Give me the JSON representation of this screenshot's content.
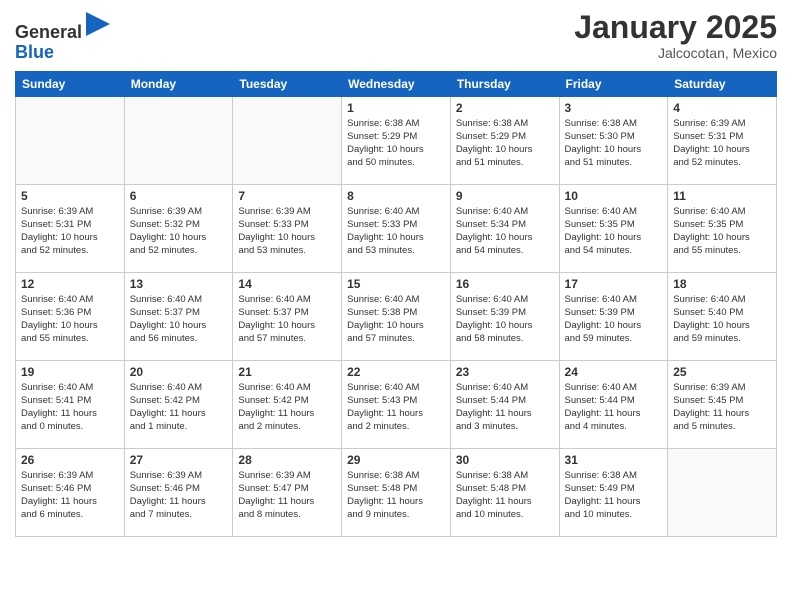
{
  "header": {
    "logo_general": "General",
    "logo_blue": "Blue",
    "month": "January 2025",
    "location": "Jalcocotan, Mexico"
  },
  "weekdays": [
    "Sunday",
    "Monday",
    "Tuesday",
    "Wednesday",
    "Thursday",
    "Friday",
    "Saturday"
  ],
  "weeks": [
    [
      {
        "day": "",
        "info": ""
      },
      {
        "day": "",
        "info": ""
      },
      {
        "day": "",
        "info": ""
      },
      {
        "day": "1",
        "info": "Sunrise: 6:38 AM\nSunset: 5:29 PM\nDaylight: 10 hours\nand 50 minutes."
      },
      {
        "day": "2",
        "info": "Sunrise: 6:38 AM\nSunset: 5:29 PM\nDaylight: 10 hours\nand 51 minutes."
      },
      {
        "day": "3",
        "info": "Sunrise: 6:38 AM\nSunset: 5:30 PM\nDaylight: 10 hours\nand 51 minutes."
      },
      {
        "day": "4",
        "info": "Sunrise: 6:39 AM\nSunset: 5:31 PM\nDaylight: 10 hours\nand 52 minutes."
      }
    ],
    [
      {
        "day": "5",
        "info": "Sunrise: 6:39 AM\nSunset: 5:31 PM\nDaylight: 10 hours\nand 52 minutes."
      },
      {
        "day": "6",
        "info": "Sunrise: 6:39 AM\nSunset: 5:32 PM\nDaylight: 10 hours\nand 52 minutes."
      },
      {
        "day": "7",
        "info": "Sunrise: 6:39 AM\nSunset: 5:33 PM\nDaylight: 10 hours\nand 53 minutes."
      },
      {
        "day": "8",
        "info": "Sunrise: 6:40 AM\nSunset: 5:33 PM\nDaylight: 10 hours\nand 53 minutes."
      },
      {
        "day": "9",
        "info": "Sunrise: 6:40 AM\nSunset: 5:34 PM\nDaylight: 10 hours\nand 54 minutes."
      },
      {
        "day": "10",
        "info": "Sunrise: 6:40 AM\nSunset: 5:35 PM\nDaylight: 10 hours\nand 54 minutes."
      },
      {
        "day": "11",
        "info": "Sunrise: 6:40 AM\nSunset: 5:35 PM\nDaylight: 10 hours\nand 55 minutes."
      }
    ],
    [
      {
        "day": "12",
        "info": "Sunrise: 6:40 AM\nSunset: 5:36 PM\nDaylight: 10 hours\nand 55 minutes."
      },
      {
        "day": "13",
        "info": "Sunrise: 6:40 AM\nSunset: 5:37 PM\nDaylight: 10 hours\nand 56 minutes."
      },
      {
        "day": "14",
        "info": "Sunrise: 6:40 AM\nSunset: 5:37 PM\nDaylight: 10 hours\nand 57 minutes."
      },
      {
        "day": "15",
        "info": "Sunrise: 6:40 AM\nSunset: 5:38 PM\nDaylight: 10 hours\nand 57 minutes."
      },
      {
        "day": "16",
        "info": "Sunrise: 6:40 AM\nSunset: 5:39 PM\nDaylight: 10 hours\nand 58 minutes."
      },
      {
        "day": "17",
        "info": "Sunrise: 6:40 AM\nSunset: 5:39 PM\nDaylight: 10 hours\nand 59 minutes."
      },
      {
        "day": "18",
        "info": "Sunrise: 6:40 AM\nSunset: 5:40 PM\nDaylight: 10 hours\nand 59 minutes."
      }
    ],
    [
      {
        "day": "19",
        "info": "Sunrise: 6:40 AM\nSunset: 5:41 PM\nDaylight: 11 hours\nand 0 minutes."
      },
      {
        "day": "20",
        "info": "Sunrise: 6:40 AM\nSunset: 5:42 PM\nDaylight: 11 hours\nand 1 minute."
      },
      {
        "day": "21",
        "info": "Sunrise: 6:40 AM\nSunset: 5:42 PM\nDaylight: 11 hours\nand 2 minutes."
      },
      {
        "day": "22",
        "info": "Sunrise: 6:40 AM\nSunset: 5:43 PM\nDaylight: 11 hours\nand 2 minutes."
      },
      {
        "day": "23",
        "info": "Sunrise: 6:40 AM\nSunset: 5:44 PM\nDaylight: 11 hours\nand 3 minutes."
      },
      {
        "day": "24",
        "info": "Sunrise: 6:40 AM\nSunset: 5:44 PM\nDaylight: 11 hours\nand 4 minutes."
      },
      {
        "day": "25",
        "info": "Sunrise: 6:39 AM\nSunset: 5:45 PM\nDaylight: 11 hours\nand 5 minutes."
      }
    ],
    [
      {
        "day": "26",
        "info": "Sunrise: 6:39 AM\nSunset: 5:46 PM\nDaylight: 11 hours\nand 6 minutes."
      },
      {
        "day": "27",
        "info": "Sunrise: 6:39 AM\nSunset: 5:46 PM\nDaylight: 11 hours\nand 7 minutes."
      },
      {
        "day": "28",
        "info": "Sunrise: 6:39 AM\nSunset: 5:47 PM\nDaylight: 11 hours\nand 8 minutes."
      },
      {
        "day": "29",
        "info": "Sunrise: 6:38 AM\nSunset: 5:48 PM\nDaylight: 11 hours\nand 9 minutes."
      },
      {
        "day": "30",
        "info": "Sunrise: 6:38 AM\nSunset: 5:48 PM\nDaylight: 11 hours\nand 10 minutes."
      },
      {
        "day": "31",
        "info": "Sunrise: 6:38 AM\nSunset: 5:49 PM\nDaylight: 11 hours\nand 10 minutes."
      },
      {
        "day": "",
        "info": ""
      }
    ]
  ]
}
